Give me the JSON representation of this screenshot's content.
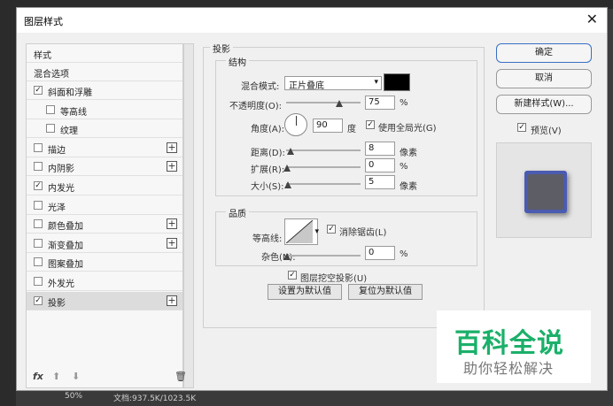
{
  "app": {
    "statusbar_zoom": "50%",
    "statusbar_doc": "文档:937.5K/1023.5K"
  },
  "dialog": {
    "title": "图层样式"
  },
  "style_list": {
    "header": "样式",
    "blend_options": "混合选项",
    "items": [
      {
        "label": "斜面和浮雕",
        "checked": true,
        "plus": false
      },
      {
        "label": "等高线",
        "checked": false,
        "plus": false
      },
      {
        "label": "纹理",
        "checked": false,
        "plus": false
      },
      {
        "label": "描边",
        "checked": false,
        "plus": true
      },
      {
        "label": "内阴影",
        "checked": false,
        "plus": true
      },
      {
        "label": "内发光",
        "checked": true,
        "plus": false
      },
      {
        "label": "光泽",
        "checked": false,
        "plus": false
      },
      {
        "label": "颜色叠加",
        "checked": false,
        "plus": true
      },
      {
        "label": "渐变叠加",
        "checked": false,
        "plus": true
      },
      {
        "label": "图案叠加",
        "checked": false,
        "plus": false
      },
      {
        "label": "外发光",
        "checked": false,
        "plus": false
      },
      {
        "label": "投影",
        "checked": true,
        "plus": true,
        "active": true
      }
    ],
    "footer": {
      "fx": "fx",
      "delete": "🗑"
    }
  },
  "drop_shadow": {
    "section_title": "投影",
    "structure": {
      "title": "结构",
      "blend_mode_label": "混合模式:",
      "blend_mode_value": "正片叠底",
      "opacity_label": "不透明度(O):",
      "opacity_value": "75",
      "opacity_unit": "%",
      "angle_label": "角度(A):",
      "angle_value": "90",
      "angle_unit": "度",
      "global_light_label": "使用全局光(G)",
      "global_light_checked": true,
      "distance_label": "距离(D):",
      "distance_value": "8",
      "distance_unit": "像素",
      "spread_label": "扩展(R):",
      "spread_value": "0",
      "spread_unit": "%",
      "size_label": "大小(S):",
      "size_value": "5",
      "size_unit": "像素"
    },
    "quality": {
      "title": "品质",
      "contour_label": "等高线:",
      "antialias_label": "消除锯齿(L)",
      "antialias_checked": true,
      "noise_label": "杂色(N):",
      "noise_value": "0",
      "noise_unit": "%"
    },
    "knockout_label": "图层挖空投影(U)",
    "knockout_checked": true,
    "set_default": "设置为默认值",
    "reset_default": "复位为默认值"
  },
  "right_buttons": {
    "ok": "确定",
    "cancel": "取消",
    "new_style": "新建样式(W)...",
    "preview_label": "预览(V)",
    "preview_checked": true
  },
  "watermark": {
    "line1": "百科全说",
    "line2": "助你轻松解决"
  },
  "colors": {
    "shadow_color": "#000000",
    "accent": "#3a6fc3"
  }
}
